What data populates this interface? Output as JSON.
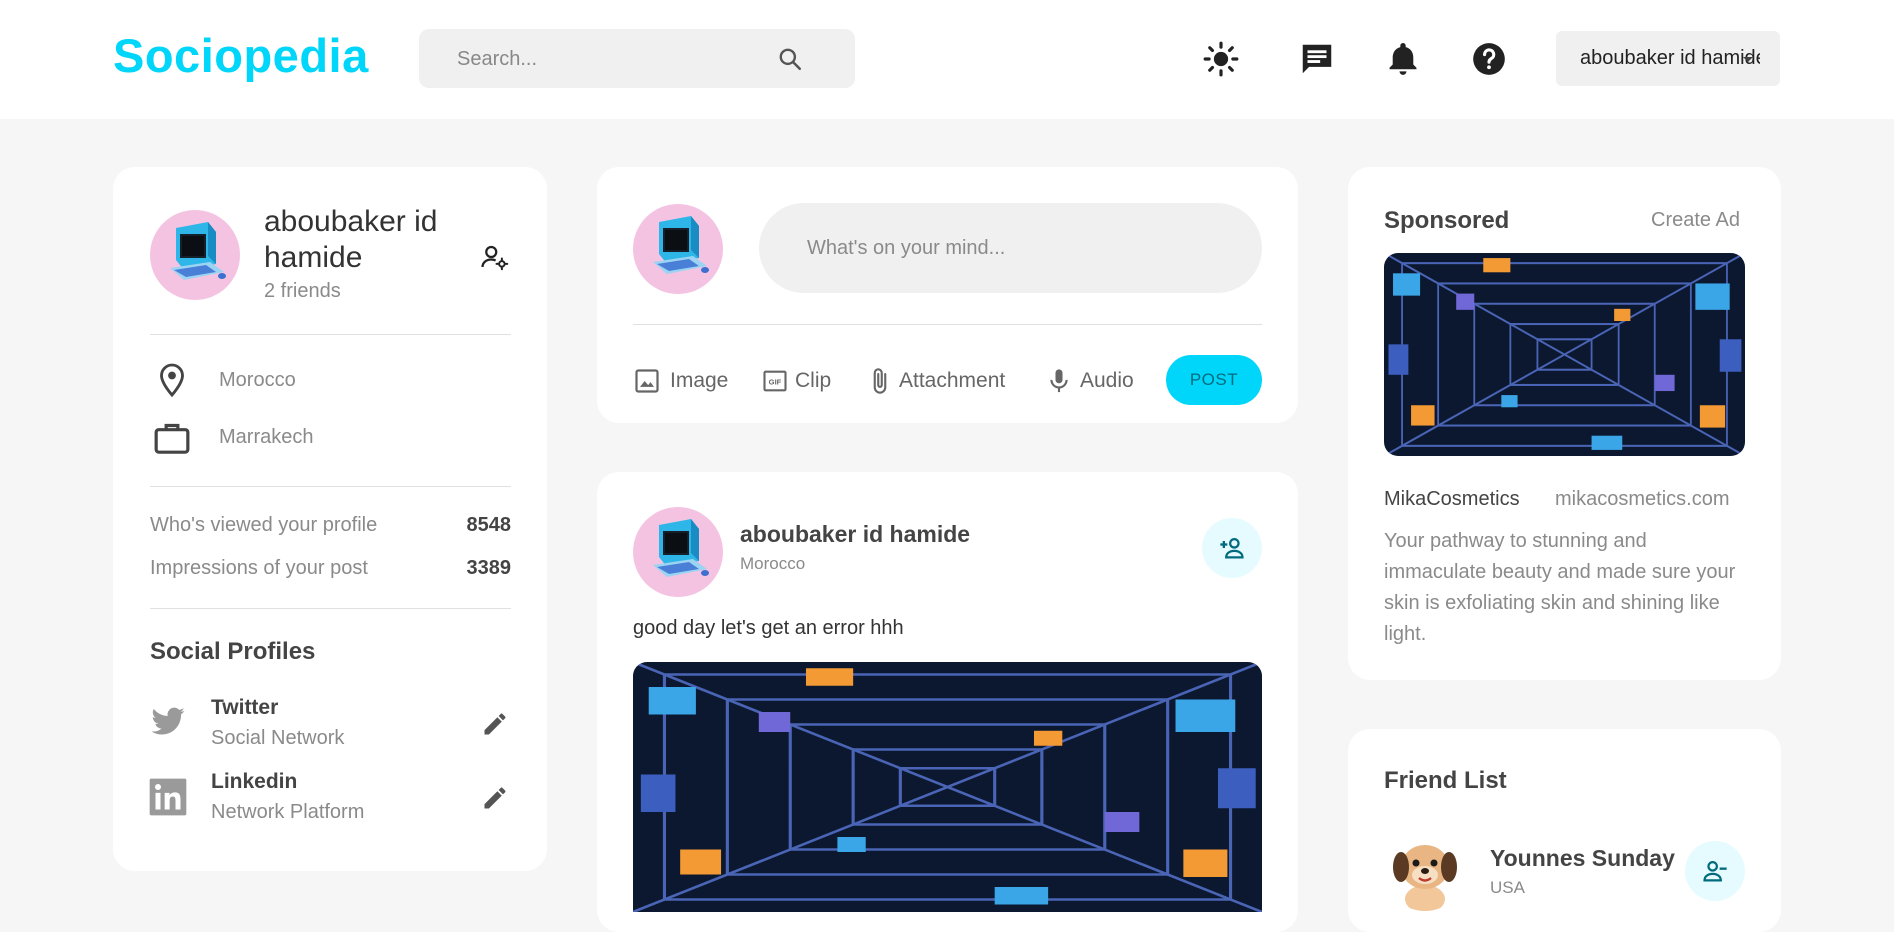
{
  "nav": {
    "logo": "Sociopedia",
    "search_placeholder": "Search...",
    "icons": [
      "sun-icon",
      "message-icon",
      "bell-icon",
      "help-icon"
    ],
    "user_select_value": "aboubaker id hamide"
  },
  "profile": {
    "name": "aboubaker id hamide",
    "friends": "2 friends",
    "location": "Morocco",
    "occupation": "Marrakech",
    "stats": [
      {
        "label": "Who's viewed your profile",
        "value": "8548"
      },
      {
        "label": "Impressions of your post",
        "value": "3389"
      }
    ],
    "social_title": "Social Profiles",
    "socials": [
      {
        "name": "Twitter",
        "type": "Social Network"
      },
      {
        "name": "Linkedin",
        "type": "Network Platform"
      }
    ]
  },
  "composer": {
    "placeholder": "What's on your mind...",
    "actions": [
      "Image",
      "Clip",
      "Attachment",
      "Audio"
    ],
    "post_label": "POST"
  },
  "post": {
    "author": "aboubaker id hamide",
    "location": "Morocco",
    "text": "good day let's get an error hhh"
  },
  "ad": {
    "title": "Sponsored",
    "create_label": "Create Ad",
    "brand": "MikaCosmetics",
    "url": "mikacosmetics.com",
    "description": "Your pathway to stunning and immaculate beauty and made sure your skin is exfoliating skin and shining like light."
  },
  "friend_list": {
    "title": "Friend List",
    "friends": [
      {
        "name": "Younnes Sunday",
        "location": "USA"
      }
    ]
  },
  "colors": {
    "brand": "#00d5fa",
    "background": "#f6f6f6",
    "card": "#ffffff",
    "avatar_bg": "#f4c3e2"
  }
}
